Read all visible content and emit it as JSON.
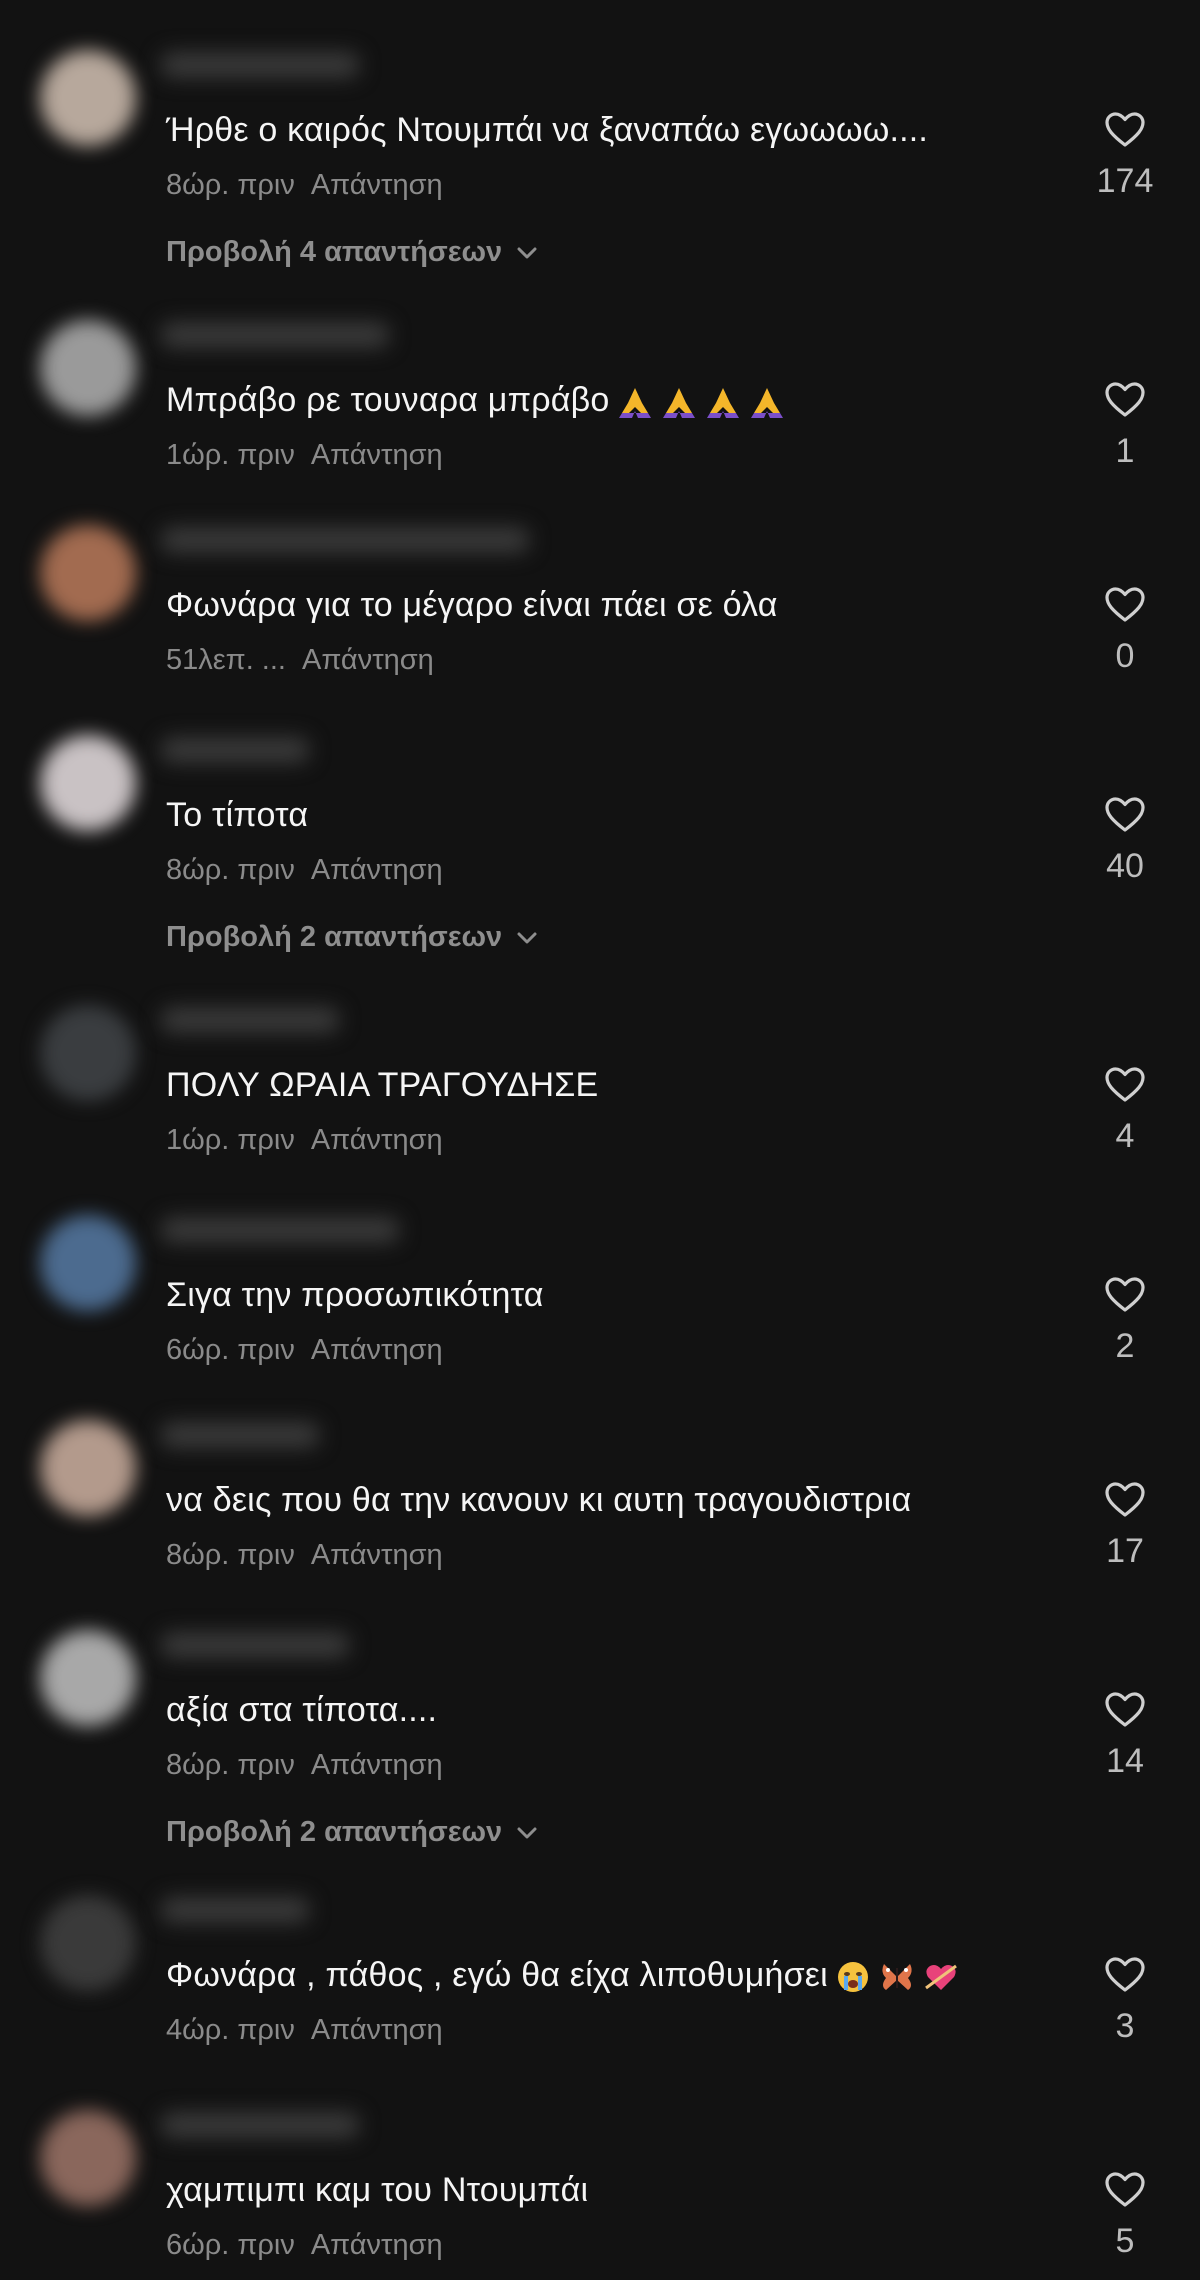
{
  "comments": [
    {
      "text": "Ήρθε ο καιρός Ντουμπάι να ξαναπάω εγωωωω....",
      "time": "8ώρ. πριν",
      "reply_label": "Απάντηση",
      "likes": "174",
      "view_replies": "Προβολή 4 απαντήσεων",
      "avatar_color": "#b7a89c",
      "emojis": []
    },
    {
      "text": "Μπράβο ρε τουναρα μπράβο",
      "time": "1ώρ. πριν",
      "reply_label": "Απάντηση",
      "likes": "1",
      "view_replies": "",
      "avatar_color": "#9a9a9a",
      "emojis": [
        "folded-hands-icon",
        "folded-hands-icon",
        "folded-hands-icon",
        "folded-hands-icon"
      ]
    },
    {
      "text": "Φωνάρα για το μέγαρο είναι πάει σε όλα",
      "time": "51λεπ. ...",
      "reply_label": "Απάντηση",
      "likes": "0",
      "view_replies": "",
      "avatar_color": "#a26b50",
      "emojis": []
    },
    {
      "text": "Το τίποτα",
      "time": "8ώρ. πριν",
      "reply_label": "Απάντηση",
      "likes": "40",
      "view_replies": "Προβολή 2 απαντήσεων",
      "avatar_color": "#c9c2c4",
      "emojis": []
    },
    {
      "text": "ΠΟΛΥ ΩΡΑΙΑ ΤΡΑΓΟΥΔΗΣΕ",
      "time": "1ώρ. πριν",
      "reply_label": "Απάντηση",
      "likes": "4",
      "view_replies": "",
      "avatar_color": "#3a3d40",
      "emojis": []
    },
    {
      "text": "Σιγα την προσωπικότητα",
      "time": "6ώρ. πριν",
      "reply_label": "Απάντηση",
      "likes": "2",
      "view_replies": "",
      "avatar_color": "#4c6b8f",
      "emojis": []
    },
    {
      "text": "να δεις που θα την κανουν κι αυτη τραγουδιστρια",
      "time": "8ώρ. πριν",
      "reply_label": "Απάντηση",
      "likes": "17",
      "view_replies": "",
      "avatar_color": "#b39a8c",
      "emojis": []
    },
    {
      "text": "αξία στα τίποτα....",
      "time": "8ώρ. πριν",
      "reply_label": "Απάντηση",
      "likes": "14",
      "view_replies": "Προβολή 2 απαντήσεων",
      "avatar_color": "#a8a8a8",
      "emojis": []
    },
    {
      "text": "Φωνάρα , πάθος , εγώ θα είχα λιποθυμήσει",
      "time": "4ώρ. πριν",
      "reply_label": "Απάντηση",
      "likes": "3",
      "view_replies": "",
      "avatar_color": "#3a3a3a",
      "emojis": [
        "crying-face-icon",
        "butterfly-icon",
        "heart-arrow-icon"
      ]
    },
    {
      "text": "χαμπιμπι καμ του Ντουμπάι",
      "time": "6ώρ. πριν",
      "reply_label": "Απάντηση",
      "likes": "5",
      "view_replies": "",
      "avatar_color": "#8a675c",
      "emojis": []
    }
  ],
  "colors": {
    "background": "#121212",
    "primary_text": "#f5f5f5",
    "secondary_text": "#8a8a8a",
    "like_count": "#bdbdbd"
  }
}
